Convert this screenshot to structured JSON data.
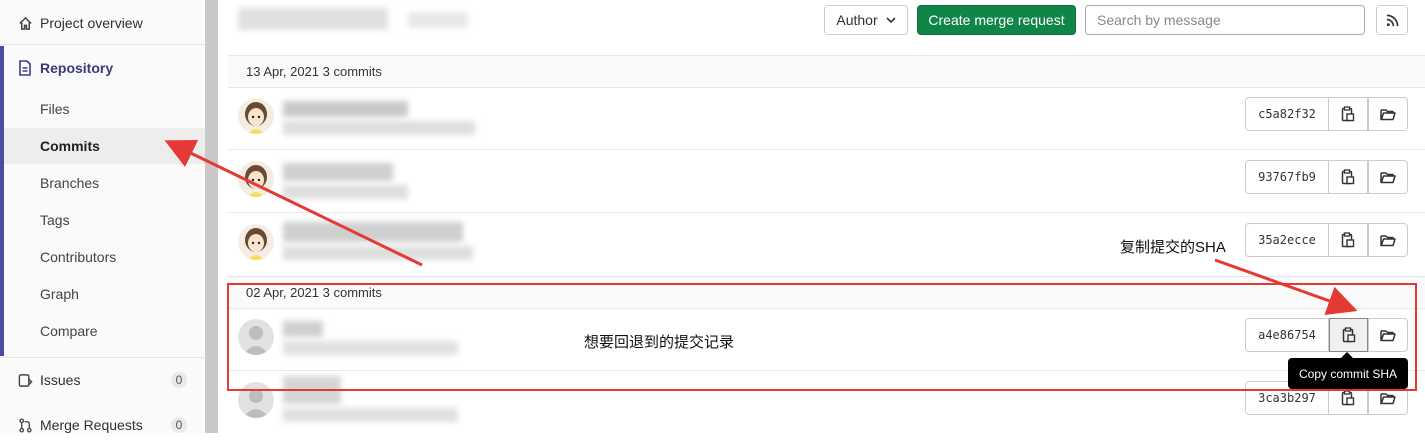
{
  "sidebar": {
    "project_overview": "Project overview",
    "repository": "Repository",
    "items": [
      {
        "label": "Files"
      },
      {
        "label": "Commits"
      },
      {
        "label": "Branches"
      },
      {
        "label": "Tags"
      },
      {
        "label": "Contributors"
      },
      {
        "label": "Graph"
      },
      {
        "label": "Compare"
      }
    ],
    "issues": {
      "label": "Issues",
      "count": "0"
    },
    "merge_requests": {
      "label": "Merge Requests",
      "count": "0"
    }
  },
  "toolbar": {
    "author_label": "Author",
    "create_mr_label": "Create merge request",
    "search_placeholder": "Search by message"
  },
  "days": [
    {
      "header": "13 Apr, 2021 3 commits",
      "commits": [
        {
          "sha": "c5a82f32"
        },
        {
          "sha": "93767fb9"
        },
        {
          "sha": "35a2ecce"
        }
      ]
    },
    {
      "header": "02 Apr, 2021 3 commits",
      "commits": [
        {
          "sha": "a4e86754"
        },
        {
          "sha": "3ca3b297"
        }
      ]
    }
  ],
  "tooltip": "Copy commit SHA",
  "annotations": {
    "copy_sha": "复制提交的SHA",
    "target_commit": "想要回退到的提交记录"
  },
  "colors": {
    "accent": "#4b4ba3",
    "create_button": "#108548",
    "annotation_red": "#e53935"
  }
}
